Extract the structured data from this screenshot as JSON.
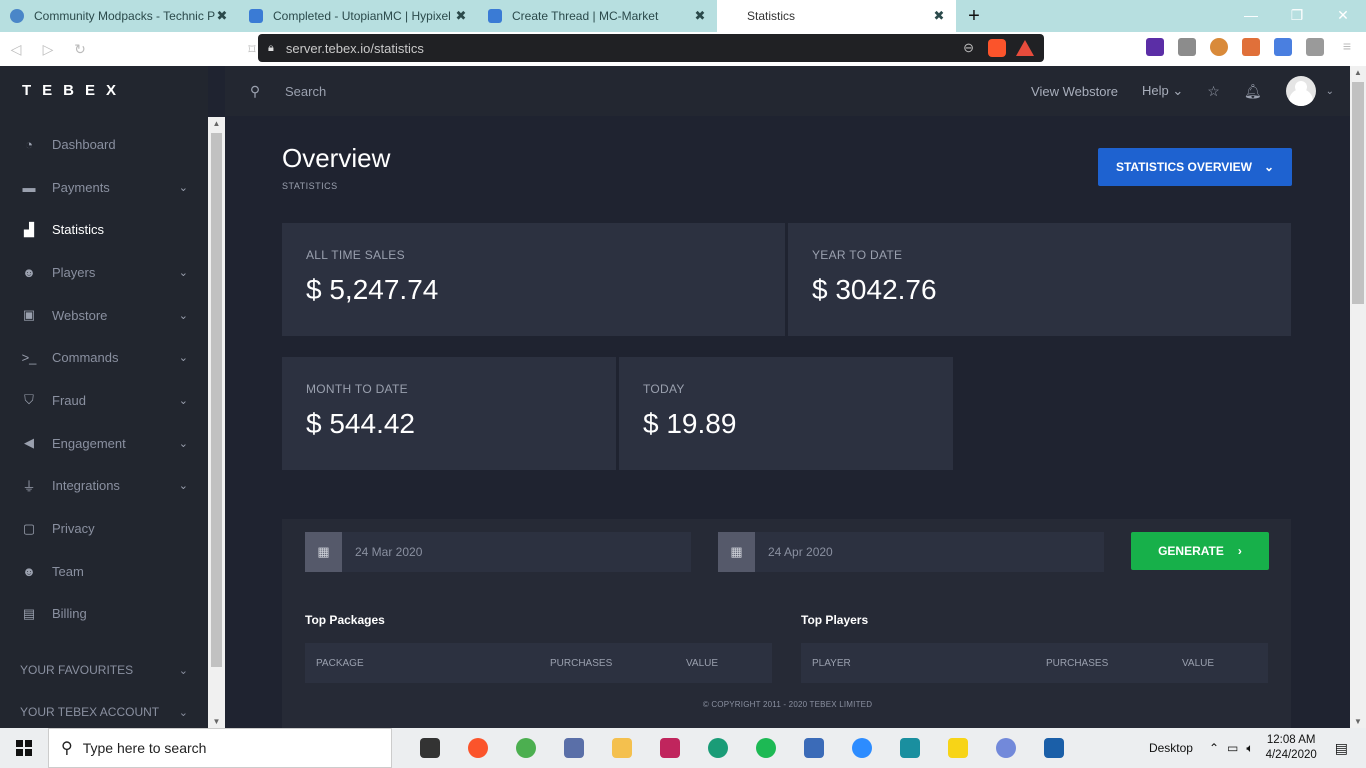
{
  "browser": {
    "tabs": [
      {
        "title": "Community Modpacks - Technic Pl",
        "icon_color": "#4a86c8",
        "active": false
      },
      {
        "title": "Completed - UtopianMC | Hypixel",
        "icon_color": "#3a7bd5",
        "active": false
      },
      {
        "title": "Create Thread | MC-Market",
        "icon_color": "#3a7bd5",
        "active": false
      },
      {
        "title": "Statistics",
        "icon_color": "#ffffff",
        "active": true
      }
    ],
    "new_tab": "+",
    "close_glyph": "✖",
    "url": "server.tebex.io/statistics",
    "window_controls": [
      "—",
      "❐",
      "✕"
    ]
  },
  "app": {
    "logo": "TEBEX",
    "sidebar": {
      "items": [
        {
          "label": "Dashboard",
          "icon": "dashboard-icon",
          "glyph": "◔",
          "chevron": false
        },
        {
          "label": "Payments",
          "icon": "credit-card-icon",
          "glyph": "▬",
          "chevron": true
        },
        {
          "label": "Statistics",
          "icon": "chart-icon",
          "glyph": "▟",
          "chevron": false,
          "active": true
        },
        {
          "label": "Players",
          "icon": "users-icon",
          "glyph": "☻",
          "chevron": true
        },
        {
          "label": "Webstore",
          "icon": "basket-icon",
          "glyph": "▣",
          "chevron": true
        },
        {
          "label": "Commands",
          "icon": "terminal-icon",
          "glyph": ">_",
          "chevron": true
        },
        {
          "label": "Fraud",
          "icon": "shield-icon",
          "glyph": "⛉",
          "chevron": true
        },
        {
          "label": "Engagement",
          "icon": "bullhorn-icon",
          "glyph": "◀",
          "chevron": true
        },
        {
          "label": "Integrations",
          "icon": "plug-icon",
          "glyph": "⏚",
          "chevron": true
        },
        {
          "label": "Privacy",
          "icon": "lock-icon",
          "glyph": "▢",
          "chevron": false
        },
        {
          "label": "Team",
          "icon": "team-icon",
          "glyph": "☻",
          "chevron": false
        },
        {
          "label": "Billing",
          "icon": "billing-icon",
          "glyph": "▤",
          "chevron": false
        }
      ],
      "sections": [
        "YOUR FAVOURITES",
        "YOUR TEBEX ACCOUNT"
      ]
    },
    "topbar": {
      "search_placeholder": "Search",
      "view_webstore": "View Webstore",
      "help": "Help"
    },
    "page": {
      "title": "Overview",
      "subtitle": "STATISTICS",
      "overview_button": "STATISTICS OVERVIEW",
      "cards": [
        {
          "label": "ALL TIME SALES",
          "value": "$ 5,247.74"
        },
        {
          "label": "YEAR TO DATE",
          "value": "$ 3042.76"
        },
        {
          "label": "MONTH TO DATE",
          "value": "$ 544.42"
        },
        {
          "label": "TODAY",
          "value": "$ 19.89"
        }
      ],
      "date_from": "24 Mar 2020",
      "date_to": "24 Apr 2020",
      "generate": "GENERATE",
      "top_packages": {
        "title": "Top Packages",
        "columns": [
          "PACKAGE",
          "PURCHASES",
          "VALUE"
        ]
      },
      "top_players": {
        "title": "Top Players",
        "columns": [
          "PLAYER",
          "PURCHASES",
          "VALUE"
        ]
      },
      "footer": "© COPYRIGHT 2011 - 2020 TEBEX LIMITED"
    }
  },
  "taskbar": {
    "search_placeholder": "Type here to search",
    "desktop_label": "Desktop",
    "time": "12:08 AM",
    "date": "4/24/2020",
    "apps": [
      {
        "name": "task-view-icon",
        "color": "#333333"
      },
      {
        "name": "brave-icon",
        "color": "#fb542b"
      },
      {
        "name": "chrome-icon",
        "color": "#4caf50"
      },
      {
        "name": "paint-icon",
        "color": "#5a6fa8"
      },
      {
        "name": "file-explorer-icon",
        "color": "#f4c04e"
      },
      {
        "name": "intellij-icon",
        "color": "#c0255d"
      },
      {
        "name": "openai-icon",
        "color": "#1a9c77"
      },
      {
        "name": "spotify-icon",
        "color": "#1db954"
      },
      {
        "name": "network-icon",
        "color": "#3b6bb8"
      },
      {
        "name": "zoom-icon",
        "color": "#2d8cff"
      },
      {
        "name": "surfshark-icon",
        "color": "#1a8f9f"
      },
      {
        "name": "sticky-notes-icon",
        "color": "#f7d417"
      },
      {
        "name": "discord-icon",
        "color": "#7289da"
      },
      {
        "name": "app-icon",
        "color": "#1b5fa8"
      }
    ]
  }
}
